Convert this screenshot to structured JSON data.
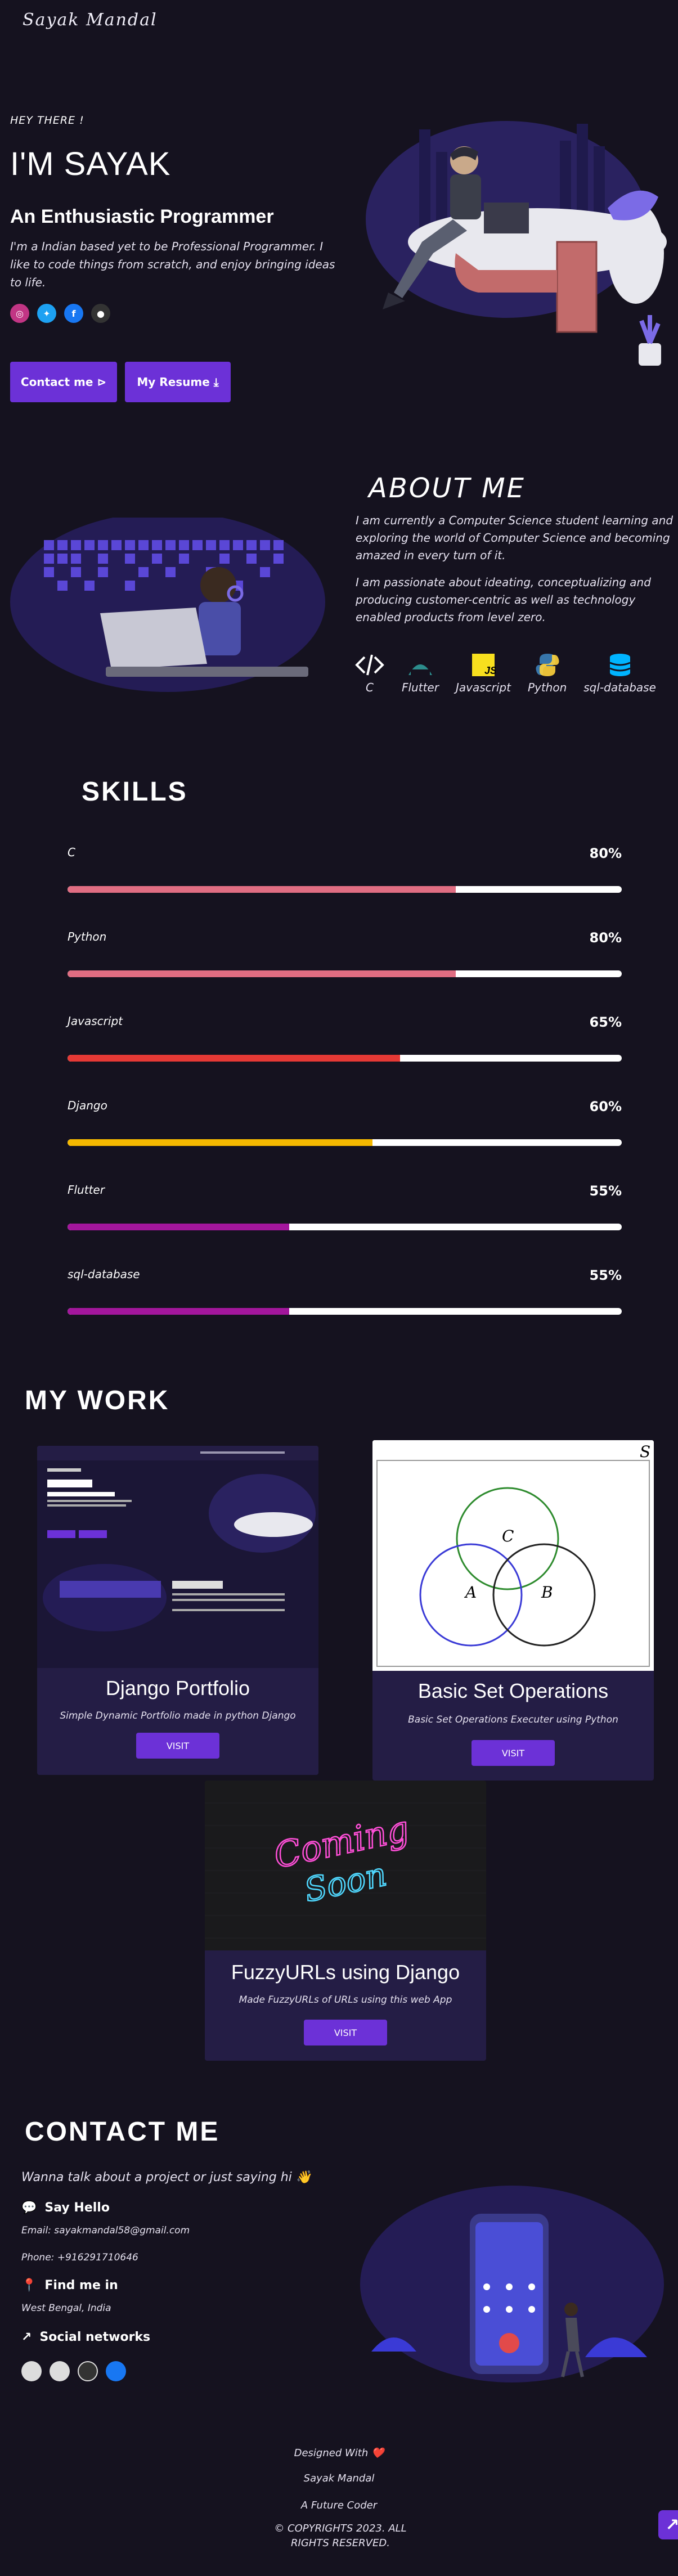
{
  "header": {
    "logo": "Sayak Mandal"
  },
  "hero": {
    "greeting": "HEY THERE !",
    "name": "I'M SAYAK",
    "tagline": "An Enthusiastic Programmer",
    "intro": "I'm a Indian based yet to be Professional Programmer. I like to code things from scratch, and enjoy bringing ideas to life.",
    "socials": [
      {
        "icon": "instagram-icon",
        "color": "#c13584"
      },
      {
        "icon": "twitter-icon",
        "color": "#1da1f2"
      },
      {
        "icon": "facebook-icon",
        "color": "#1877f2"
      },
      {
        "icon": "github-icon",
        "color": "#333333"
      }
    ],
    "contact_btn": "Contact me ⊳",
    "resume_btn": "My Resume ⤓"
  },
  "about": {
    "title": "ABOUT ME",
    "p1": "I am currently a Computer Science student learning and exploring the world of Computer Science and becoming amazed in every turn of it.",
    "p2": "I am passionate about ideating, conceptualizing and producing customer-centric as well as technology enabled products from level zero.",
    "techs": [
      "C",
      "Flutter",
      "Javascript",
      "Python",
      "sql-database"
    ]
  },
  "skills": {
    "title": "SKILLS",
    "items": [
      {
        "name": "C",
        "label": "80%",
        "value": 0.7,
        "color": "#e06d82"
      },
      {
        "name": "Python",
        "label": "80%",
        "value": 0.7,
        "color": "#e06d82"
      },
      {
        "name": "Javascript",
        "label": "65%",
        "value": 0.6,
        "color": "#e53935"
      },
      {
        "name": "Django",
        "label": "60%",
        "value": 0.55,
        "color": "#f5b800"
      },
      {
        "name": "Flutter",
        "label": "55%",
        "value": 0.4,
        "color": "#a3169c"
      },
      {
        "name": "sql-database",
        "label": "55%",
        "value": 0.4,
        "color": "#a3169c"
      }
    ]
  },
  "work": {
    "title": "MY WORK",
    "projects": [
      {
        "title": "Django Portfolio",
        "desc": "Simple Dynamic Portfolio made in python Django",
        "button": "VISIT"
      },
      {
        "title": "Basic Set Operations",
        "desc": "Basic Set Operations Executer using Python",
        "button": "VISIT"
      },
      {
        "title": "FuzzyURLs using Django",
        "desc": "Made FuzzyURLs of URLs using this web App",
        "button": "VISIT"
      }
    ],
    "thumb_venn": {
      "s": "S",
      "a": "A",
      "b": "B",
      "c": "C"
    },
    "thumb_coming": {
      "line1": "Coming",
      "line2": "Soon"
    }
  },
  "contact": {
    "title": "CONTACT ME",
    "lead": "Wanna talk about a project or just saying hi 👋",
    "say_hello": "Say Hello",
    "email": "Email: sayakmandal58@gmail.com",
    "phone": "Phone: +916291710646",
    "find_me": "Find me in",
    "location": "West Bengal, India",
    "social_networks": "Social networks"
  },
  "footer": {
    "designed": "Designed With ❤️",
    "author": "Sayak Mandal",
    "tagline": "A Future Coder",
    "copyright": "© COPYRIGHTS 2023. ALL RIGHTS RESERVED."
  }
}
